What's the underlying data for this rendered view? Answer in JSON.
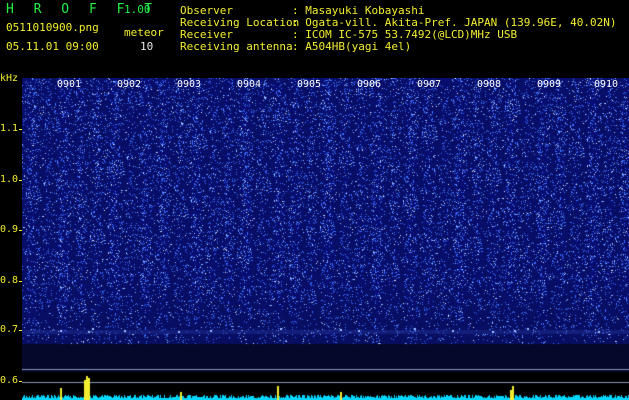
{
  "header": {
    "app_name": "H R O F F T",
    "version": "1.00",
    "filename": "0511010900.png",
    "datetime": "05.11.01 09:00",
    "meteor_label": "meteor",
    "meteor_count": "10",
    "fields": [
      {
        "label": "Observer",
        "value": ": Masayuki Kobayashi"
      },
      {
        "label": "Receiving Location",
        "value": ": Ogata-vill. Akita-Pref. JAPAN (139.96E, 40.02N)"
      },
      {
        "label": "Receiver",
        "value": ": ICOM IC-575 53.7492(@LCD)MHz USB"
      },
      {
        "label": "Receiving antenna",
        "value": ": A504HB(yagi 4el)"
      }
    ]
  },
  "y_axis": {
    "unit": "kHz",
    "ticks": [
      "1.1",
      "1.0",
      "0.9",
      "0.8",
      "0.7",
      "0.6"
    ]
  },
  "x_axis": {
    "ticks": [
      "0901",
      "0902",
      "0903",
      "0904",
      "0905",
      "0906",
      "0907",
      "0908",
      "0909",
      "0910"
    ]
  },
  "colors": {
    "background": "#000000",
    "spectrum_base": "#0a1a80",
    "spectrum_noise": "#4a78ff",
    "level_trace": "#00e0ff",
    "meteor_spike": "#f2ee30",
    "label_yellow": "#f2ee30",
    "title_green": "#22ee44"
  }
}
